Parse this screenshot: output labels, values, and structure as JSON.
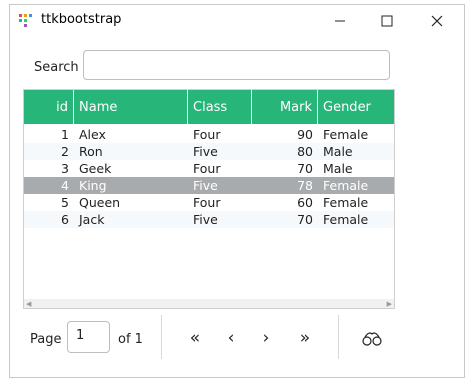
{
  "window": {
    "title": "ttkbootstrap",
    "icons": [
      "app-icon",
      "minimize-icon",
      "maximize-icon",
      "close-icon"
    ]
  },
  "search": {
    "label": "Search",
    "value": "",
    "placeholder": ""
  },
  "table": {
    "columns": [
      "id",
      "Name",
      "Class",
      "Mark",
      "Gender"
    ],
    "header_color": "#27b579",
    "selected_row": 3,
    "rows": [
      [
        "1",
        "Alex",
        "Four",
        "90",
        "Female"
      ],
      [
        "2",
        "Ron",
        "Five",
        "80",
        "Male"
      ],
      [
        "3",
        "Geek",
        "Four",
        "70",
        "Male"
      ],
      [
        "4",
        "King",
        "Five",
        "78",
        "Female"
      ],
      [
        "5",
        "Queen",
        "Four",
        "60",
        "Female"
      ],
      [
        "6",
        "Jack",
        "Five",
        "70",
        "Female"
      ]
    ]
  },
  "pagination": {
    "page_label": "Page",
    "page_value": "1",
    "of_label": "of 1",
    "first": "«",
    "prev": "‹",
    "next": "›",
    "last": "»"
  }
}
